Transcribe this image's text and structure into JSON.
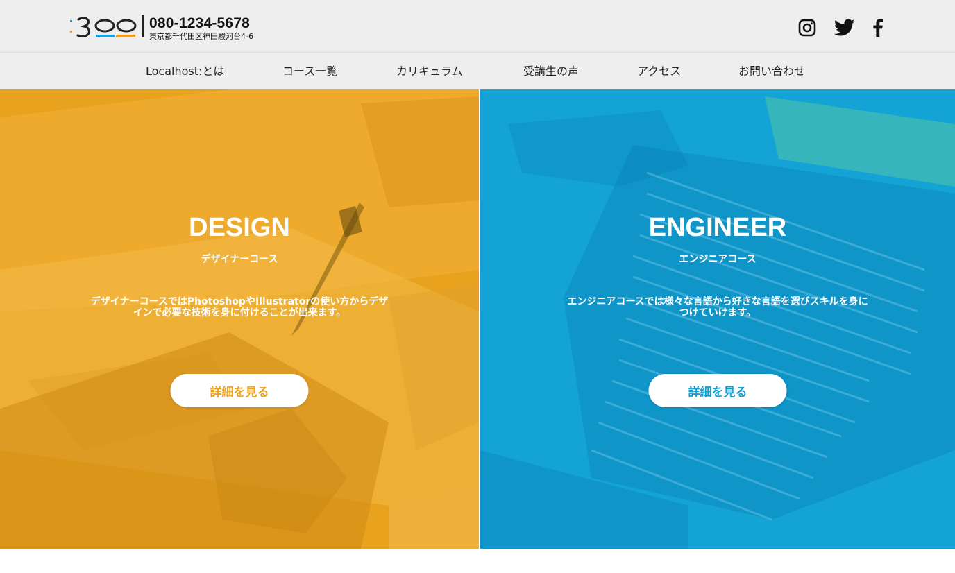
{
  "header": {
    "phone": "080-1234-5678",
    "address": "東京都千代田区神田駿河台4-6",
    "social": [
      "instagram-icon",
      "twitter-icon",
      "facebook-icon"
    ]
  },
  "nav": {
    "items": [
      "Localhost:とは",
      "コース一覧",
      "カリキュラム",
      "受講生の声",
      "アクセス",
      "お問い合わせ"
    ]
  },
  "panels": {
    "design": {
      "title": "DESIGN",
      "subtitle": "デザイナーコース",
      "description": "デザイナーコースではPhotoshopやIllustratorの使い方からデザインで必要な技術を身に付けることが出来ます。",
      "button": "詳細を見る",
      "accent": "#e9a21e"
    },
    "engineer": {
      "title": "ENGINEER",
      "subtitle": "エンジニアコース",
      "description": "エンジニアコースでは様々な言語から好きな言語を選びスキルを身につけていけます。",
      "button": "詳細を見る",
      "accent": "#12a0d3"
    }
  },
  "colors": {
    "header_bg": "#eeeeee",
    "logo_blue": "#1aa0d8",
    "logo_orange": "#f0a020"
  }
}
